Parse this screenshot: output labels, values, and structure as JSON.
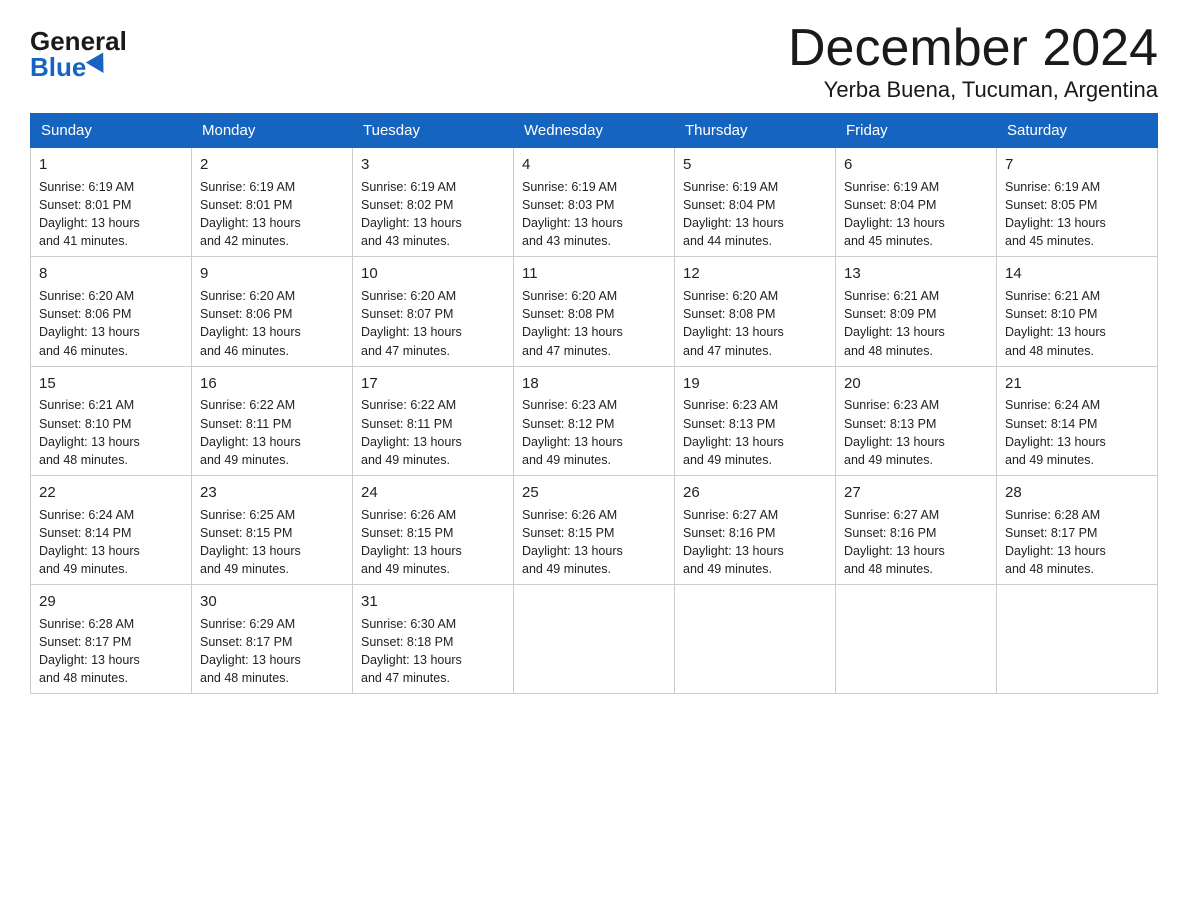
{
  "logo": {
    "general": "General",
    "blue": "Blue"
  },
  "title": "December 2024",
  "location": "Yerba Buena, Tucuman, Argentina",
  "headers": [
    "Sunday",
    "Monday",
    "Tuesday",
    "Wednesday",
    "Thursday",
    "Friday",
    "Saturday"
  ],
  "weeks": [
    [
      {
        "day": "1",
        "sunrise": "6:19 AM",
        "sunset": "8:01 PM",
        "daylight": "13 hours and 41 minutes."
      },
      {
        "day": "2",
        "sunrise": "6:19 AM",
        "sunset": "8:01 PM",
        "daylight": "13 hours and 42 minutes."
      },
      {
        "day": "3",
        "sunrise": "6:19 AM",
        "sunset": "8:02 PM",
        "daylight": "13 hours and 43 minutes."
      },
      {
        "day": "4",
        "sunrise": "6:19 AM",
        "sunset": "8:03 PM",
        "daylight": "13 hours and 43 minutes."
      },
      {
        "day": "5",
        "sunrise": "6:19 AM",
        "sunset": "8:04 PM",
        "daylight": "13 hours and 44 minutes."
      },
      {
        "day": "6",
        "sunrise": "6:19 AM",
        "sunset": "8:04 PM",
        "daylight": "13 hours and 45 minutes."
      },
      {
        "day": "7",
        "sunrise": "6:19 AM",
        "sunset": "8:05 PM",
        "daylight": "13 hours and 45 minutes."
      }
    ],
    [
      {
        "day": "8",
        "sunrise": "6:20 AM",
        "sunset": "8:06 PM",
        "daylight": "13 hours and 46 minutes."
      },
      {
        "day": "9",
        "sunrise": "6:20 AM",
        "sunset": "8:06 PM",
        "daylight": "13 hours and 46 minutes."
      },
      {
        "day": "10",
        "sunrise": "6:20 AM",
        "sunset": "8:07 PM",
        "daylight": "13 hours and 47 minutes."
      },
      {
        "day": "11",
        "sunrise": "6:20 AM",
        "sunset": "8:08 PM",
        "daylight": "13 hours and 47 minutes."
      },
      {
        "day": "12",
        "sunrise": "6:20 AM",
        "sunset": "8:08 PM",
        "daylight": "13 hours and 47 minutes."
      },
      {
        "day": "13",
        "sunrise": "6:21 AM",
        "sunset": "8:09 PM",
        "daylight": "13 hours and 48 minutes."
      },
      {
        "day": "14",
        "sunrise": "6:21 AM",
        "sunset": "8:10 PM",
        "daylight": "13 hours and 48 minutes."
      }
    ],
    [
      {
        "day": "15",
        "sunrise": "6:21 AM",
        "sunset": "8:10 PM",
        "daylight": "13 hours and 48 minutes."
      },
      {
        "day": "16",
        "sunrise": "6:22 AM",
        "sunset": "8:11 PM",
        "daylight": "13 hours and 49 minutes."
      },
      {
        "day": "17",
        "sunrise": "6:22 AM",
        "sunset": "8:11 PM",
        "daylight": "13 hours and 49 minutes."
      },
      {
        "day": "18",
        "sunrise": "6:23 AM",
        "sunset": "8:12 PM",
        "daylight": "13 hours and 49 minutes."
      },
      {
        "day": "19",
        "sunrise": "6:23 AM",
        "sunset": "8:13 PM",
        "daylight": "13 hours and 49 minutes."
      },
      {
        "day": "20",
        "sunrise": "6:23 AM",
        "sunset": "8:13 PM",
        "daylight": "13 hours and 49 minutes."
      },
      {
        "day": "21",
        "sunrise": "6:24 AM",
        "sunset": "8:14 PM",
        "daylight": "13 hours and 49 minutes."
      }
    ],
    [
      {
        "day": "22",
        "sunrise": "6:24 AM",
        "sunset": "8:14 PM",
        "daylight": "13 hours and 49 minutes."
      },
      {
        "day": "23",
        "sunrise": "6:25 AM",
        "sunset": "8:15 PM",
        "daylight": "13 hours and 49 minutes."
      },
      {
        "day": "24",
        "sunrise": "6:26 AM",
        "sunset": "8:15 PM",
        "daylight": "13 hours and 49 minutes."
      },
      {
        "day": "25",
        "sunrise": "6:26 AM",
        "sunset": "8:15 PM",
        "daylight": "13 hours and 49 minutes."
      },
      {
        "day": "26",
        "sunrise": "6:27 AM",
        "sunset": "8:16 PM",
        "daylight": "13 hours and 49 minutes."
      },
      {
        "day": "27",
        "sunrise": "6:27 AM",
        "sunset": "8:16 PM",
        "daylight": "13 hours and 48 minutes."
      },
      {
        "day": "28",
        "sunrise": "6:28 AM",
        "sunset": "8:17 PM",
        "daylight": "13 hours and 48 minutes."
      }
    ],
    [
      {
        "day": "29",
        "sunrise": "6:28 AM",
        "sunset": "8:17 PM",
        "daylight": "13 hours and 48 minutes."
      },
      {
        "day": "30",
        "sunrise": "6:29 AM",
        "sunset": "8:17 PM",
        "daylight": "13 hours and 48 minutes."
      },
      {
        "day": "31",
        "sunrise": "6:30 AM",
        "sunset": "8:18 PM",
        "daylight": "13 hours and 47 minutes."
      },
      null,
      null,
      null,
      null
    ]
  ],
  "labels": {
    "sunrise": "Sunrise:",
    "sunset": "Sunset:",
    "daylight": "Daylight:"
  }
}
